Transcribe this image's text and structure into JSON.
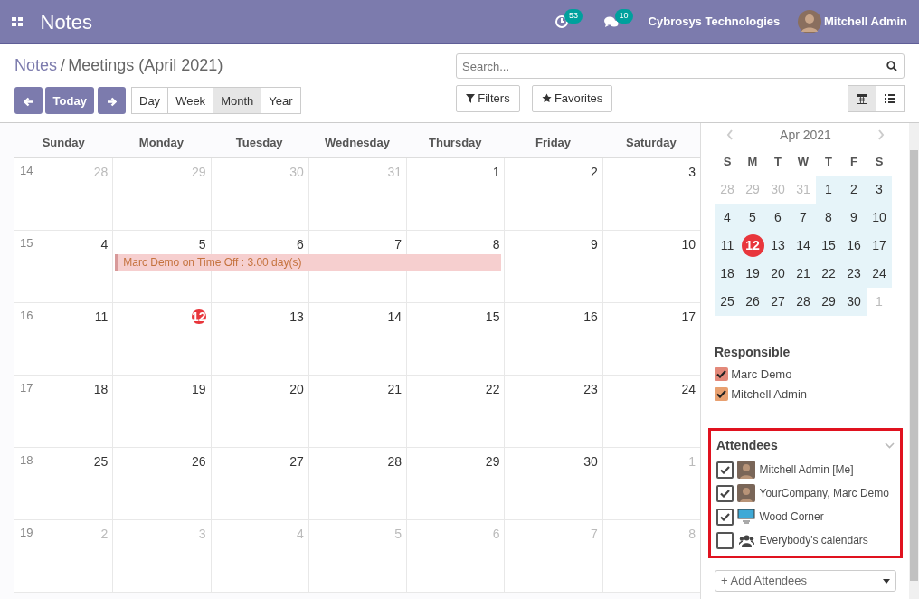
{
  "navbar": {
    "app_title": "Notes",
    "activity_count": "53",
    "message_count": "10",
    "company": "Cybrosys Technologies",
    "user": "Mitchell Admin"
  },
  "breadcrumb": {
    "parent": "Notes",
    "separator": "/",
    "current": "Meetings (April 2021)"
  },
  "search": {
    "placeholder": "Search..."
  },
  "nav_buttons": {
    "today": "Today"
  },
  "scales": [
    {
      "label": "Day",
      "selected": false
    },
    {
      "label": "Week",
      "selected": false
    },
    {
      "label": "Month",
      "selected": true
    },
    {
      "label": "Year",
      "selected": false
    }
  ],
  "filters": {
    "filters": "Filters",
    "favorites": "Favorites"
  },
  "views": [
    {
      "kind": "calendar",
      "selected": true
    },
    {
      "kind": "list",
      "selected": false
    }
  ],
  "calendar": {
    "weekdays": [
      "Sunday",
      "Monday",
      "Tuesday",
      "Wednesday",
      "Thursday",
      "Friday",
      "Saturday"
    ],
    "weeks": [
      {
        "number": "14",
        "days": [
          {
            "label": "28",
            "muted": true,
            "today": false
          },
          {
            "label": "29",
            "muted": true,
            "today": false
          },
          {
            "label": "30",
            "muted": true,
            "today": false
          },
          {
            "label": "31",
            "muted": true,
            "today": false
          },
          {
            "label": "1",
            "muted": false,
            "today": false
          },
          {
            "label": "2",
            "muted": false,
            "today": false
          },
          {
            "label": "3",
            "muted": false,
            "today": false
          }
        ]
      },
      {
        "number": "15",
        "days": [
          {
            "label": "4",
            "muted": false,
            "today": false
          },
          {
            "label": "5",
            "muted": false,
            "today": false
          },
          {
            "label": "6",
            "muted": false,
            "today": false
          },
          {
            "label": "7",
            "muted": false,
            "today": false
          },
          {
            "label": "8",
            "muted": false,
            "today": false
          },
          {
            "label": "9",
            "muted": false,
            "today": false
          },
          {
            "label": "10",
            "muted": false,
            "today": false
          }
        ],
        "events": [
          {
            "label": "Marc Demo on Time Off : 3.00 day(s)",
            "days": [
              false,
              true,
              true,
              true,
              true,
              false,
              false
            ],
            "color": "#f6cfcf"
          }
        ]
      },
      {
        "number": "16",
        "days": [
          {
            "label": "11",
            "muted": false,
            "today": false
          },
          {
            "label": "12",
            "muted": false,
            "today": true
          },
          {
            "label": "13",
            "muted": false,
            "today": false
          },
          {
            "label": "14",
            "muted": false,
            "today": false
          },
          {
            "label": "15",
            "muted": false,
            "today": false
          },
          {
            "label": "16",
            "muted": false,
            "today": false
          },
          {
            "label": "17",
            "muted": false,
            "today": false
          }
        ]
      },
      {
        "number": "17",
        "days": [
          {
            "label": "18",
            "muted": false,
            "today": false
          },
          {
            "label": "19",
            "muted": false,
            "today": false
          },
          {
            "label": "20",
            "muted": false,
            "today": false
          },
          {
            "label": "21",
            "muted": false,
            "today": false
          },
          {
            "label": "22",
            "muted": false,
            "today": false
          },
          {
            "label": "23",
            "muted": false,
            "today": false
          },
          {
            "label": "24",
            "muted": false,
            "today": false
          }
        ]
      },
      {
        "number": "18",
        "days": [
          {
            "label": "25",
            "muted": false,
            "today": false
          },
          {
            "label": "26",
            "muted": false,
            "today": false
          },
          {
            "label": "27",
            "muted": false,
            "today": false
          },
          {
            "label": "28",
            "muted": false,
            "today": false
          },
          {
            "label": "29",
            "muted": false,
            "today": false
          },
          {
            "label": "30",
            "muted": false,
            "today": false
          },
          {
            "label": "1",
            "muted": true,
            "today": false
          }
        ]
      },
      {
        "number": "19",
        "days": [
          {
            "label": "2",
            "muted": true,
            "today": false
          },
          {
            "label": "3",
            "muted": true,
            "today": false
          },
          {
            "label": "4",
            "muted": true,
            "today": false
          },
          {
            "label": "5",
            "muted": true,
            "today": false
          },
          {
            "label": "6",
            "muted": true,
            "today": false
          },
          {
            "label": "7",
            "muted": true,
            "today": false
          },
          {
            "label": "8",
            "muted": true,
            "today": false
          }
        ]
      }
    ]
  },
  "mini_calendar": {
    "title": "Apr 2021",
    "weekdays": [
      "S",
      "M",
      "T",
      "W",
      "T",
      "F",
      "S"
    ],
    "weeks": [
      [
        {
          "label": "28",
          "in_range": false,
          "muted": true,
          "selected": false
        },
        {
          "label": "29",
          "in_range": false,
          "muted": true,
          "selected": false
        },
        {
          "label": "30",
          "in_range": false,
          "muted": true,
          "selected": false
        },
        {
          "label": "31",
          "in_range": false,
          "muted": true,
          "selected": false
        },
        {
          "label": "1",
          "in_range": true,
          "muted": false,
          "selected": false
        },
        {
          "label": "2",
          "in_range": true,
          "muted": false,
          "selected": false
        },
        {
          "label": "3",
          "in_range": true,
          "muted": false,
          "selected": false
        }
      ],
      [
        {
          "label": "4",
          "in_range": true,
          "muted": false,
          "selected": false
        },
        {
          "label": "5",
          "in_range": true,
          "muted": false,
          "selected": false
        },
        {
          "label": "6",
          "in_range": true,
          "muted": false,
          "selected": false
        },
        {
          "label": "7",
          "in_range": true,
          "muted": false,
          "selected": false
        },
        {
          "label": "8",
          "in_range": true,
          "muted": false,
          "selected": false
        },
        {
          "label": "9",
          "in_range": true,
          "muted": false,
          "selected": false
        },
        {
          "label": "10",
          "in_range": true,
          "muted": false,
          "selected": false
        }
      ],
      [
        {
          "label": "11",
          "in_range": true,
          "muted": false,
          "selected": false
        },
        {
          "label": "12",
          "in_range": true,
          "muted": false,
          "selected": true
        },
        {
          "label": "13",
          "in_range": true,
          "muted": false,
          "selected": false
        },
        {
          "label": "14",
          "in_range": true,
          "muted": false,
          "selected": false
        },
        {
          "label": "15",
          "in_range": true,
          "muted": false,
          "selected": false
        },
        {
          "label": "16",
          "in_range": true,
          "muted": false,
          "selected": false
        },
        {
          "label": "17",
          "in_range": true,
          "muted": false,
          "selected": false
        }
      ],
      [
        {
          "label": "18",
          "in_range": true,
          "muted": false,
          "selected": false
        },
        {
          "label": "19",
          "in_range": true,
          "muted": false,
          "selected": false
        },
        {
          "label": "20",
          "in_range": true,
          "muted": false,
          "selected": false
        },
        {
          "label": "21",
          "in_range": true,
          "muted": false,
          "selected": false
        },
        {
          "label": "22",
          "in_range": true,
          "muted": false,
          "selected": false
        },
        {
          "label": "23",
          "in_range": true,
          "muted": false,
          "selected": false
        },
        {
          "label": "24",
          "in_range": true,
          "muted": false,
          "selected": false
        }
      ],
      [
        {
          "label": "25",
          "in_range": true,
          "muted": false,
          "selected": false
        },
        {
          "label": "26",
          "in_range": true,
          "muted": false,
          "selected": false
        },
        {
          "label": "27",
          "in_range": true,
          "muted": false,
          "selected": false
        },
        {
          "label": "28",
          "in_range": true,
          "muted": false,
          "selected": false
        },
        {
          "label": "29",
          "in_range": true,
          "muted": false,
          "selected": false
        },
        {
          "label": "30",
          "in_range": true,
          "muted": false,
          "selected": false
        },
        {
          "label": "1",
          "in_range": false,
          "muted": true,
          "selected": false
        }
      ]
    ]
  },
  "responsible": {
    "title": "Responsible",
    "items": [
      {
        "label": "Marc Demo",
        "checked": true,
        "color": "#e3897a"
      },
      {
        "label": "Mitchell Admin",
        "checked": true,
        "color": "#e8a070"
      }
    ]
  },
  "attendees": {
    "title": "Attendees",
    "items": [
      {
        "label": "Mitchell Admin [Me]",
        "checked": true,
        "kind": "person"
      },
      {
        "label": "YourCompany, Marc Demo",
        "checked": true,
        "kind": "person"
      },
      {
        "label": "Wood Corner",
        "checked": true,
        "kind": "company"
      },
      {
        "label": "Everybody's calendars",
        "checked": false,
        "kind": "everyone"
      }
    ],
    "add_placeholder": "+ Add Attendees"
  }
}
